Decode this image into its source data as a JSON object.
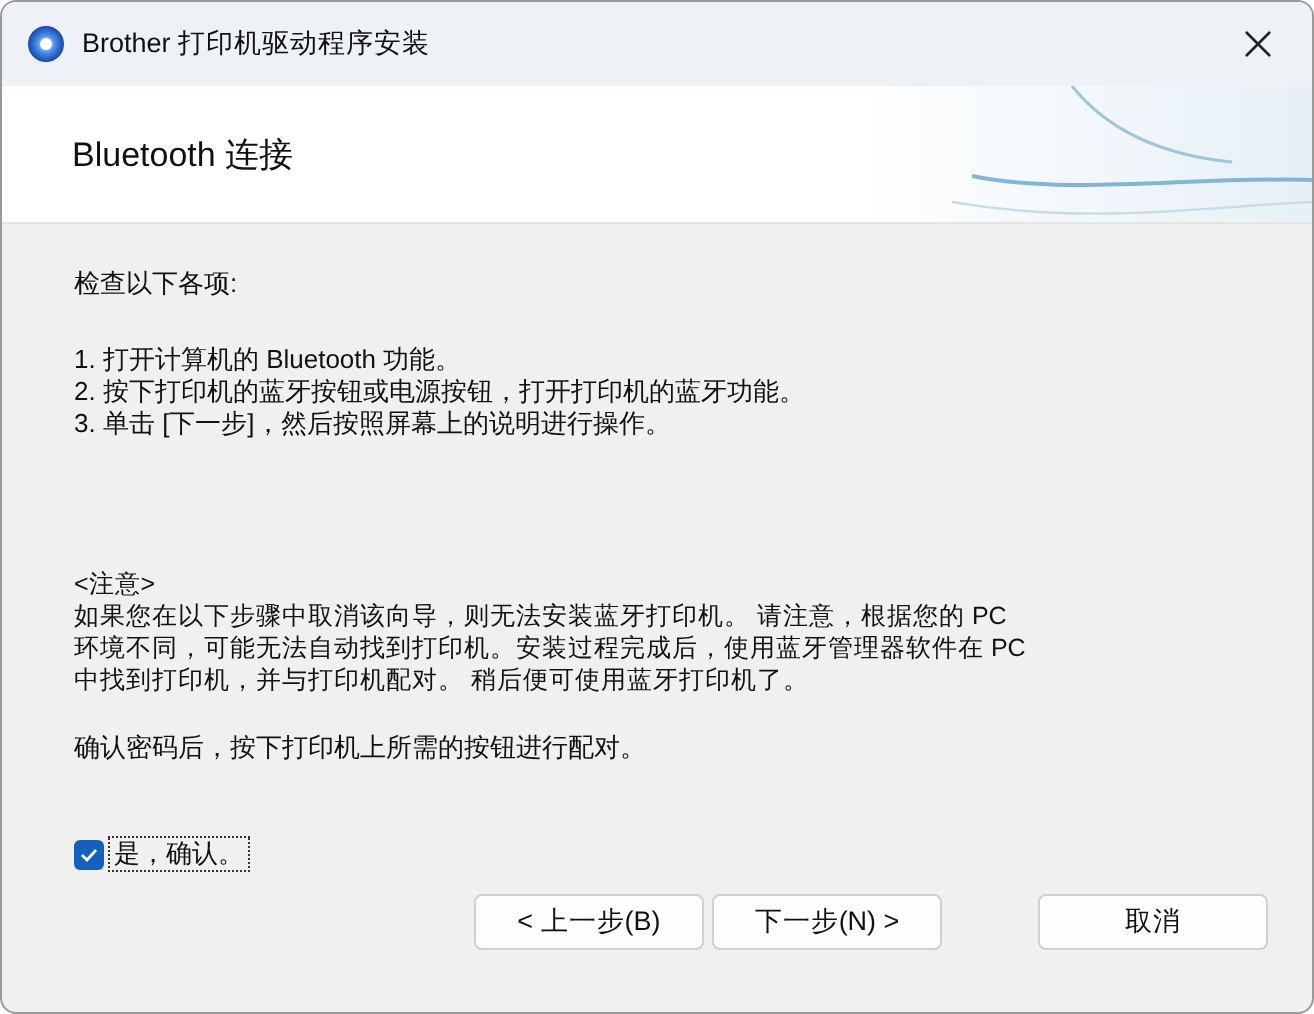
{
  "window": {
    "title": "Brother 打印机驱动程序安装"
  },
  "header": {
    "title": "Bluetooth 连接"
  },
  "intro": "检查以下各项:",
  "steps": [
    "1. 打开计算机的 Bluetooth 功能。",
    "2. 按下打印机的蓝牙按钮或电源按钮，打开打印机的蓝牙功能。",
    "3. 单击 [下一步]，然后按照屏幕上的说明进行操作。"
  ],
  "note": {
    "heading": "<注意>",
    "lines": [
      "如果您在以下步骤中取消该向导，则无法安装蓝牙打印机。 请注意，根据您的 PC",
      "环境不同，可能无法自动找到打印机。安装过程完成后，使用蓝牙管理器软件在 PC",
      "中找到打印机，并与打印机配对。 稍后便可使用蓝牙打印机了。"
    ]
  },
  "confirm_text": "确认密码后，按下打印机上所需的按钮进行配对。",
  "checkbox": {
    "label": "是，确认。",
    "checked": true
  },
  "buttons": [
    {
      "label": "< 上一步(B)",
      "kind": "nav"
    },
    {
      "label": "下一步(N) >",
      "kind": "nav"
    },
    {
      "label": "取消",
      "kind": "cancel"
    }
  ]
}
